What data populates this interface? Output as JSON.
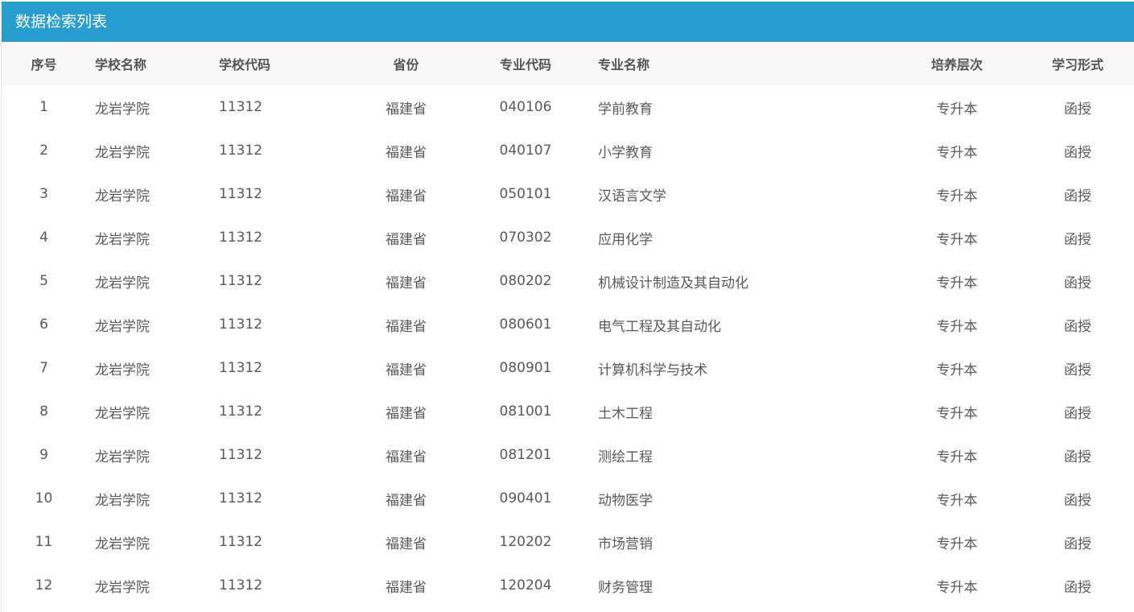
{
  "panel": {
    "title": "数据检索列表"
  },
  "table": {
    "headers": [
      "序号",
      "学校名称",
      "学校代码",
      "省份",
      "专业代码",
      "专业名称",
      "培养层次",
      "学习形式"
    ],
    "rows": [
      [
        "1",
        "龙岩学院",
        "11312",
        "福建省",
        "040106",
        "学前教育",
        "专升本",
        "函授"
      ],
      [
        "2",
        "龙岩学院",
        "11312",
        "福建省",
        "040107",
        "小学教育",
        "专升本",
        "函授"
      ],
      [
        "3",
        "龙岩学院",
        "11312",
        "福建省",
        "050101",
        "汉语言文学",
        "专升本",
        "函授"
      ],
      [
        "4",
        "龙岩学院",
        "11312",
        "福建省",
        "070302",
        "应用化学",
        "专升本",
        "函授"
      ],
      [
        "5",
        "龙岩学院",
        "11312",
        "福建省",
        "080202",
        "机械设计制造及其自动化",
        "专升本",
        "函授"
      ],
      [
        "6",
        "龙岩学院",
        "11312",
        "福建省",
        "080601",
        "电气工程及其自动化",
        "专升本",
        "函授"
      ],
      [
        "7",
        "龙岩学院",
        "11312",
        "福建省",
        "080901",
        "计算机科学与技术",
        "专升本",
        "函授"
      ],
      [
        "8",
        "龙岩学院",
        "11312",
        "福建省",
        "081001",
        "土木工程",
        "专升本",
        "函授"
      ],
      [
        "9",
        "龙岩学院",
        "11312",
        "福建省",
        "081201",
        "测绘工程",
        "专升本",
        "函授"
      ],
      [
        "10",
        "龙岩学院",
        "11312",
        "福建省",
        "090401",
        "动物医学",
        "专升本",
        "函授"
      ],
      [
        "11",
        "龙岩学院",
        "11312",
        "福建省",
        "120202",
        "市场营销",
        "专升本",
        "函授"
      ],
      [
        "12",
        "龙岩学院",
        "11312",
        "福建省",
        "120204",
        "财务管理",
        "专升本",
        "函授"
      ]
    ]
  },
  "colors": {
    "header_bar": "#289dd0",
    "table_head_bg": "#f7f7f7",
    "text": "#595959"
  }
}
